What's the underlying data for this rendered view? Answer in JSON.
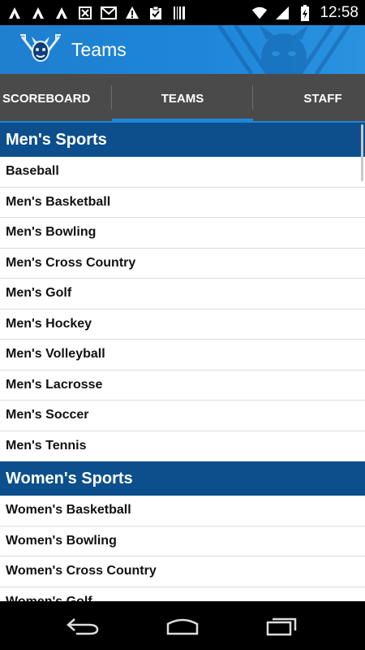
{
  "status_bar": {
    "time": "12:58",
    "left_icons": [
      "app-a-icon",
      "app-a-icon",
      "app-a-icon",
      "missed-call-icon",
      "gmail-icon",
      "warning-icon",
      "clipboard-icon",
      "barcode-icon"
    ],
    "right_icons": [
      "wifi-icon",
      "signal-icon",
      "battery-icon"
    ]
  },
  "action_bar": {
    "title": "Teams",
    "accent": "#1e86d8"
  },
  "tabs": [
    {
      "label": "SCOREBOARD",
      "selected": false
    },
    {
      "label": "TEAMS",
      "selected": true
    },
    {
      "label": "STAFF",
      "selected": false
    }
  ],
  "sections": [
    {
      "title": "Men's Sports",
      "items": [
        "Baseball",
        "Men's Basketball",
        "Men's Bowling",
        "Men's Cross Country",
        "Men's Golf",
        "Men's Hockey",
        "Men's Volleyball",
        "Men's Lacrosse",
        "Men's Soccer",
        "Men's Tennis"
      ]
    },
    {
      "title": "Women's Sports",
      "items": [
        "Women's Basketball",
        "Women's Bowling",
        "Women's Cross Country",
        "Women's Golf"
      ]
    }
  ],
  "colors": {
    "section_header": "#0c4f8c",
    "tab_bg": "#4a4a4a"
  },
  "nav_bar": {
    "buttons": [
      "back-icon",
      "home-icon",
      "recent-apps-icon"
    ]
  }
}
